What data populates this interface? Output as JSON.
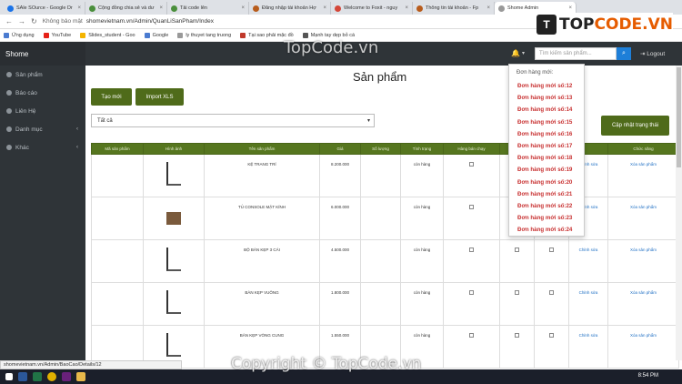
{
  "browser": {
    "tabs": [
      {
        "label": "SAle SOurce - Google Dr"
      },
      {
        "label": "Cộng đồng chia sẻ và dư"
      },
      {
        "label": "Tải code lên"
      },
      {
        "label": "Đăng nhập tài khoản Hợ"
      },
      {
        "label": "Welcome to Foxit - nguy"
      },
      {
        "label": "Thông tin tài khoản - Fp"
      },
      {
        "label": "Shome Admin"
      }
    ],
    "address_prefix": "Không bảo mật",
    "address": "shomevietnam.vn/Admin/QuanLiSanPham/Index",
    "bookmarks": [
      "Ứng dụng",
      "YouTube",
      "Slides_student - Goo",
      "Google",
      "ly thuyet tang truong",
      "Tại sao phải mặc đồ",
      "Mạnh tay dẹp bỏ cá"
    ]
  },
  "logo": {
    "mark": "T",
    "text_a": "TOP",
    "text_b": "CODE.VN"
  },
  "watermark_top": "TopCode.vn",
  "watermark_bottom": "Copyright © TopCode.vn",
  "app": {
    "brand": "Shome",
    "sidebar": [
      {
        "label": "Sản phẩm",
        "icon": "product-icon",
        "caret": ""
      },
      {
        "label": "Báo cáo",
        "icon": "report-icon",
        "caret": ""
      },
      {
        "label": "Liên Hệ",
        "icon": "contact-icon",
        "caret": ""
      },
      {
        "label": "Danh mục",
        "icon": "category-icon",
        "caret": "‹"
      },
      {
        "label": "Khác",
        "icon": "other-icon",
        "caret": "‹"
      }
    ],
    "search_placeholder": "Tìm kiếm sản phẩm...",
    "logout": "Logout",
    "page_title": "Sản phẩm",
    "btn_new": "Tạo mới",
    "btn_import": "Import XLS",
    "btn_update": "Cập nhật trạng thái",
    "filter_value": "Tất cả",
    "table_headers": [
      "Mã sản phẩm",
      "Hình ảnh",
      "Tên sản phẩm",
      "Giá",
      "Số lượng",
      "Tình trạng",
      "Hàng bán chạy",
      "",
      "",
      "",
      "Chức năng"
    ],
    "rows": [
      {
        "name": "KỆ TRANG TRÍ",
        "price": "8.200.000",
        "status": "còn hàng",
        "edit": "Chỉnh sửa",
        "delete": "Xóa sản phẩm"
      },
      {
        "name": "TỦ CONSOLE MẶT KÍNH",
        "price": "6.000.000",
        "status": "còn hàng",
        "edit": "Chỉnh sửa",
        "delete": "Xóa sản phẩm"
      },
      {
        "name": "BỘ BÀN KẸP 3 CÁI",
        "price": "4.500.000",
        "status": "còn hàng",
        "edit": "Chỉnh sửa",
        "delete": "Xóa sản phẩm"
      },
      {
        "name": "BÀN KẸP VUÔNG",
        "price": "1.800.000",
        "status": "còn hàng",
        "edit": "Chỉnh sửa",
        "delete": "Xóa sản phẩm"
      },
      {
        "name": "BÀN KẸP VÒNG CUNG",
        "price": "1.550.000",
        "status": "còn hàng",
        "edit": "Chỉnh sửa",
        "delete": "Xóa sản phẩm"
      }
    ],
    "dropdown": {
      "header": "Đơn hàng mới:",
      "items": [
        "Đơn hàng mới số:12",
        "Đơn hàng mới số:13",
        "Đơn hàng mới số:14",
        "Đơn hàng mới số:15",
        "Đơn hàng mới số:16",
        "Đơn hàng mới số:17",
        "Đơn hàng mới số:18",
        "Đơn hàng mới số:19",
        "Đơn hàng mới số:20",
        "Đơn hàng mới số:21",
        "Đơn hàng mới số:22",
        "Đơn hàng mới số:23",
        "Đơn hàng mới số:24"
      ]
    }
  },
  "status_url": "shomevietnam.vn/Admin/BaoCao/Details/12",
  "clock": "8:54 PM",
  "colors": {
    "accent_green": "#4f6b1a",
    "sidebar_dark": "#2f3438",
    "order_red": "#c83131"
  }
}
